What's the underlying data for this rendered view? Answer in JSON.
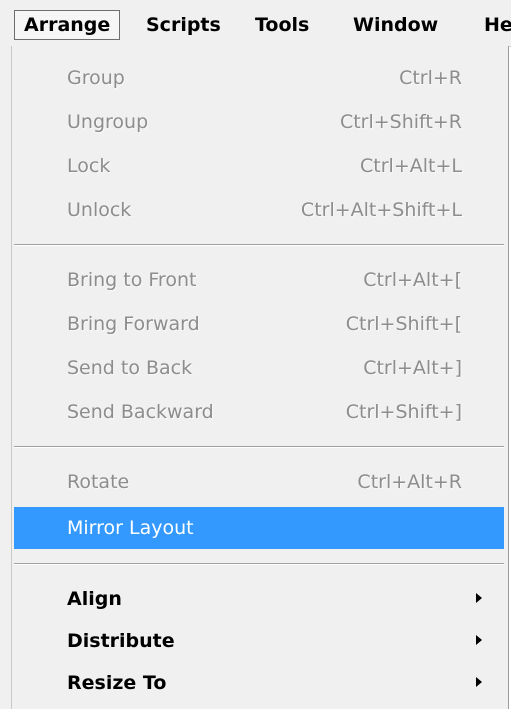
{
  "menubar": {
    "arrange": "Arrange",
    "scripts": "Scripts",
    "tools": "Tools",
    "window": "Window",
    "help": "He"
  },
  "menu": {
    "group": {
      "label": "Group",
      "shortcut": "Ctrl+R",
      "enabled": false
    },
    "ungroup": {
      "label": "Ungroup",
      "shortcut": "Ctrl+Shift+R",
      "enabled": false
    },
    "lock": {
      "label": "Lock",
      "shortcut": "Ctrl+Alt+L",
      "enabled": false
    },
    "unlock": {
      "label": "Unlock",
      "shortcut": "Ctrl+Alt+Shift+L",
      "enabled": false
    },
    "bring_to_front": {
      "label": "Bring to Front",
      "shortcut": "Ctrl+Alt+[",
      "enabled": false
    },
    "bring_forward": {
      "label": "Bring Forward",
      "shortcut": "Ctrl+Shift+[",
      "enabled": false
    },
    "send_to_back": {
      "label": "Send to Back",
      "shortcut": "Ctrl+Alt+]",
      "enabled": false
    },
    "send_backward": {
      "label": "Send Backward",
      "shortcut": "Ctrl+Shift+]",
      "enabled": false
    },
    "rotate": {
      "label": "Rotate",
      "shortcut": "Ctrl+Alt+R",
      "enabled": false
    },
    "mirror_layout": {
      "label": "Mirror Layout",
      "highlighted": true
    },
    "align": {
      "label": "Align"
    },
    "distribute": {
      "label": "Distribute"
    },
    "resize_to": {
      "label": "Resize To"
    }
  },
  "colors": {
    "highlight": "#3399ff",
    "disabled_text": "#8d8d8d",
    "menu_background": "#f0f0f0"
  }
}
